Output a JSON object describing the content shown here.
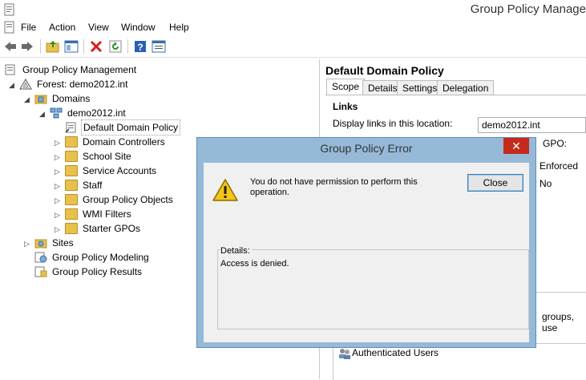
{
  "window": {
    "title": "Group Policy Manage"
  },
  "menu": [
    "File",
    "Action",
    "View",
    "Window",
    "Help"
  ],
  "toolbar_icons": [
    "back-icon",
    "forward-icon",
    "up-folder-icon",
    "show-hide-tree-icon",
    "delete-icon",
    "refresh-icon",
    "help-icon",
    "properties-icon"
  ],
  "tree": {
    "root": "Group Policy Management",
    "forest": "Forest: demo2012.int",
    "domains": "Domains",
    "domain": "demo2012.int",
    "children": [
      "Default Domain Policy",
      "Domain Controllers",
      "School Site",
      "Service Accounts",
      "Staff",
      "Group Policy Objects",
      "WMI Filters",
      "Starter GPOs"
    ],
    "sites": "Sites",
    "modeling": "Group Policy Modeling",
    "results": "Group Policy Results"
  },
  "right": {
    "title": "Default Domain Policy",
    "tabs": [
      "Scope",
      "Details",
      "Settings",
      "Delegation"
    ],
    "active_tab": "Scope",
    "links_heading": "Links",
    "display_label": "Display links in this location:",
    "location_value": "demo2012.int",
    "gpo_label": "GPO:",
    "col_enforced": "Enforced",
    "enforced_value": "No",
    "groups_text": "groups, use",
    "auth_users": "Authenticated Users"
  },
  "dialog": {
    "title": "Group Policy Error",
    "message": "You do not have permission to perform this operation.",
    "close_label": "Close",
    "details_label": "Details:",
    "details_text": "Access is denied.",
    "titlebar_close": "✕"
  }
}
